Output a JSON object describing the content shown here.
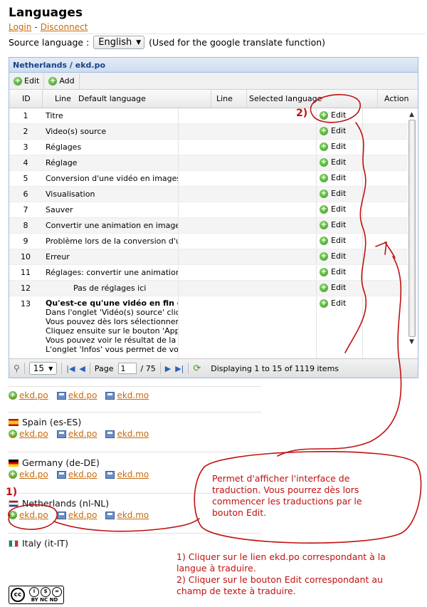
{
  "page": {
    "title": "Languages",
    "login": "Login",
    "separator": "-",
    "disconnect": "Disconnect"
  },
  "source": {
    "label": "Source language :",
    "selected": "English",
    "note": "(Used for the google translate function)"
  },
  "grid": {
    "title": "Netherlands / ekd.po",
    "toolbar": {
      "edit": "Edit",
      "add": "Add"
    },
    "columns": {
      "id": "ID",
      "line": "Line",
      "default": "Default language",
      "line2": "Line",
      "selected": "Selected language",
      "action": "Action"
    },
    "edit_label": "Edit",
    "rows": [
      {
        "id": "1",
        "text": "Titre"
      },
      {
        "id": "2",
        "text": "Video(s) source"
      },
      {
        "id": "3",
        "text": "Réglages"
      },
      {
        "id": "4",
        "text": "Réglage"
      },
      {
        "id": "5",
        "text": "Conversion d'une vidéo en images"
      },
      {
        "id": "6",
        "text": "Visualisation"
      },
      {
        "id": "7",
        "text": "Sauver"
      },
      {
        "id": "8",
        "text": "Convertir une animation en images"
      },
      {
        "id": "9",
        "text": "Problème lors de la conversion d'une vi"
      },
      {
        "id": "10",
        "text": "Erreur"
      },
      {
        "id": "11",
        "text": "Réglages: convertir une animation en i"
      },
      {
        "id": "12",
        "text": "Pas de réglages ici"
      }
    ],
    "row13": {
      "id": "13",
      "lines": [
        "Qu'est-ce qu'une vidéo en fin de comp",
        "Dans l'onglet 'Vidéo(s) source' cliquez",
        "Vous pouvez dès lors sélectionner une",
        "Cliquez ensuite sur le bouton 'Applique",
        "Vous pouvez voir le résultat de la conve",
        "L'onglet 'Infos' vous permet de voir les"
      ]
    },
    "pager": {
      "page_size": "15",
      "page_label": "Page",
      "page_value": "1",
      "of": "/ 75",
      "display": "Displaying 1 to 15 of 1119 items"
    }
  },
  "files": {
    "po": "ekd.po",
    "d": "ekd.po",
    "mo": "ekd.mo"
  },
  "languages": [
    {
      "name": "Spain (es-ES)"
    },
    {
      "name": "Germany (de-DE)"
    },
    {
      "name": "Netherlands (nl-NL)"
    },
    {
      "name": "Italy (it-IT)"
    }
  ],
  "annotations": {
    "marker1": "1)",
    "marker2": "2)",
    "bubble": [
      "Permet d'afficher l'interface de",
      "traduction. Vous pourrez dès lors",
      "commencer les traductions par le",
      "bouton  Edit."
    ],
    "steps": [
      "1) Cliquer sur le lien ekd.po correspondant à la",
      "langue à traduire.",
      "2) Cliquer sur le bouton Edit correspondant au",
      "champ de texte à traduire."
    ]
  },
  "license": {
    "cc": "cc",
    "terms": "BY  NC  ND"
  },
  "colors": {
    "link": "#c76b0e",
    "annotation": "#c01010",
    "grid_border": "#99bbe8"
  }
}
